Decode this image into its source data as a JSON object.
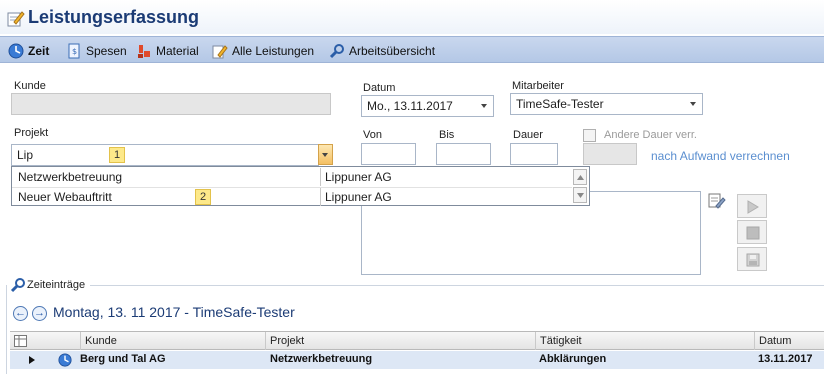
{
  "window": {
    "title": "Leistungserfassung"
  },
  "tabs": [
    {
      "label": "Zeit",
      "icon": "clock-icon",
      "active": true
    },
    {
      "label": "Spesen",
      "icon": "receipt-icon",
      "active": false
    },
    {
      "label": "Material",
      "icon": "material-icon",
      "active": false
    },
    {
      "label": "Alle Leistungen",
      "icon": "edit-icon",
      "active": false
    },
    {
      "label": "Arbeitsübersicht",
      "icon": "overview-icon",
      "active": false
    }
  ],
  "form": {
    "kunde_label": "Kunde",
    "kunde_value": "",
    "datum_label": "Datum",
    "datum_value": "Mo., 13.11.2017",
    "mitarbeiter_label": "Mitarbeiter",
    "mitarbeiter_value": "TimeSafe-Tester",
    "projekt_label": "Projekt",
    "projekt_value": "Lip",
    "von_label": "Von",
    "bis_label": "Bis",
    "dauer_label": "Dauer",
    "andere_dauer_label": "Andere Dauer verr.",
    "aufwand_link": "nach Aufwand verrechnen"
  },
  "markers": {
    "one": "1",
    "two": "2"
  },
  "dropdown": {
    "rows": [
      {
        "project": "Netzwerkbetreuung",
        "customer": "Lippuner AG"
      },
      {
        "project": "Neuer Webauftritt",
        "customer": "Lippuner AG"
      }
    ]
  },
  "entries": {
    "section_label": "Zeiteinträge",
    "date_header": "Montag, 13. 11 2017 - TimeSafe-Tester",
    "columns": [
      "Kunde",
      "Projekt",
      "Tätigkeit",
      "Datum"
    ],
    "rows": [
      {
        "kunde": "Berg und Tal AG",
        "projekt": "Netzwerkbetreuung",
        "taetigkeit": "Abklärungen",
        "datum": "13.11.2017"
      }
    ]
  },
  "colors": {
    "title": "#1b3b75",
    "tabbar": "#b4c8e6",
    "link": "#5b8fd0",
    "marker": "#fde98a",
    "row_highlight": "#dde7f5"
  }
}
